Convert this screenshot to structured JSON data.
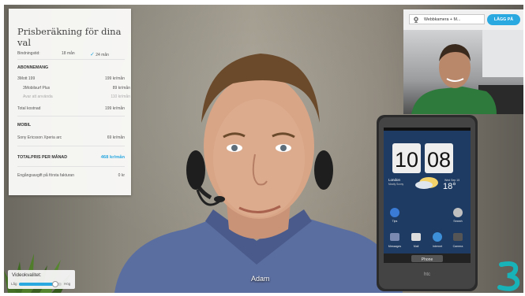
{
  "colors": {
    "accent": "#2aa8e0"
  },
  "price_panel": {
    "title": "Prisberäkning för dina val",
    "binding": {
      "label": "Bindningstid:",
      "option_a": "18 mån",
      "option_b": "24 mån",
      "selected": "24 mån"
    },
    "subscription": {
      "header": "ABONNEMANG",
      "rows": [
        {
          "label": "3Mott 199",
          "value": "199 kr/mån"
        },
        {
          "label": "3Mobilsurf Plus",
          "value": "89 kr/mån"
        },
        {
          "label": "Avar att använda",
          "value": "110 kr/mån"
        },
        {
          "label": "Total kostnad",
          "value": "199 kr/mån"
        }
      ]
    },
    "mobile": {
      "header": "MOBIL",
      "rows": [
        {
          "label": "Sony Ericsson Xperia arc",
          "value": "69 kr/mån"
        }
      ]
    },
    "total": {
      "label": "TOTALPRIS PER MÅNAD",
      "value": "468 kr/mån"
    },
    "fee": {
      "label": "Engångsavgift på första fakturan",
      "value": "0 kr"
    }
  },
  "self_view": {
    "camera_select": "Webbkamera + M...",
    "camera_icon": "webcam-icon",
    "hangup_label": "LÄGG PÅ"
  },
  "phone": {
    "time_hours": "10",
    "time_minutes": "08",
    "city": "London",
    "weather_text": "Mostly Sunny",
    "date": "Wed Sep 15",
    "temperature": "18°",
    "brand": "htc",
    "apps_row1": [
      "Tips",
      "",
      "",
      "Search"
    ],
    "apps_row2": [
      "Messages",
      "Mail",
      "Internet",
      "Camera"
    ],
    "dock_label": "Phone"
  },
  "video_quality": {
    "label": "Videokvalitet:",
    "low": "Låg",
    "high": "Hög",
    "level": 0.85
  },
  "caller_name": "Adam",
  "brand_logo": "three-logo-icon"
}
